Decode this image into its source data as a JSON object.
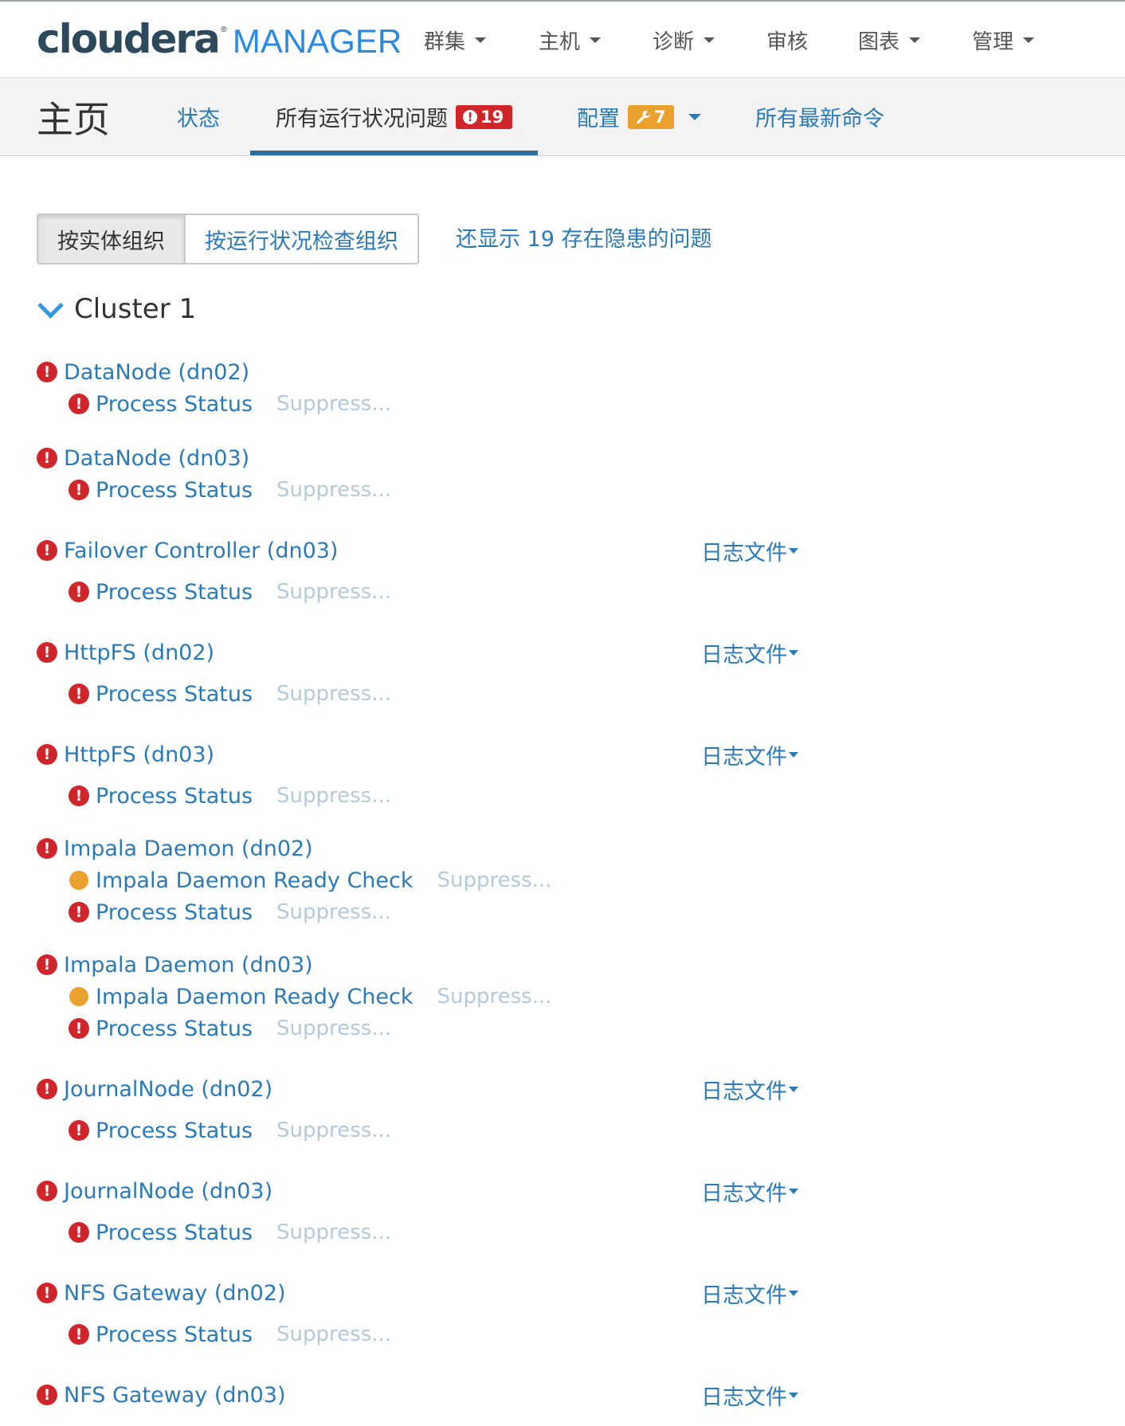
{
  "header": {
    "logo_main": "cloudera",
    "logo_reg": "®",
    "logo_product": "MANAGER",
    "nav": [
      {
        "label": "群集",
        "dropdown": true
      },
      {
        "label": "主机",
        "dropdown": true
      },
      {
        "label": "诊断",
        "dropdown": true
      },
      {
        "label": "审核",
        "dropdown": false
      },
      {
        "label": "图表",
        "dropdown": true
      },
      {
        "label": "管理",
        "dropdown": true
      }
    ]
  },
  "subheader": {
    "title": "主页",
    "tabs": [
      {
        "label": "状态"
      },
      {
        "label": "所有运行状况问题",
        "badge": "19",
        "badge_icon": "!",
        "active": true
      },
      {
        "label": "配置",
        "badge": "7",
        "badge_icon": "wrench-icon",
        "dropdown": true
      },
      {
        "label": "所有最新命令"
      }
    ]
  },
  "controls": {
    "group_by_entity": "按实体组织",
    "group_by_check": "按运行状况检查组织",
    "show_concerning": "还显示 19 存在隐患的问题"
  },
  "cluster": {
    "name": "Cluster 1"
  },
  "colors": {
    "link": "#2a7ab8",
    "critical": "#d0262b",
    "warning": "#eba12e",
    "suppress": "#b4c9da",
    "tab_underline": "#2f6f9f"
  },
  "logs_label": "日志文件",
  "suppress_label": "Suppress...",
  "entities": [
    {
      "name": "DataNode (dn02)",
      "status": "critical",
      "logs": false,
      "checks": [
        {
          "name": "Process Status",
          "status": "critical"
        }
      ]
    },
    {
      "name": "DataNode (dn03)",
      "status": "critical",
      "logs": false,
      "checks": [
        {
          "name": "Process Status",
          "status": "critical"
        }
      ]
    },
    {
      "name": "Failover Controller (dn03)",
      "status": "critical",
      "logs": true,
      "checks": [
        {
          "name": "Process Status",
          "status": "critical"
        }
      ]
    },
    {
      "name": "HttpFS (dn02)",
      "status": "critical",
      "logs": true,
      "checks": [
        {
          "name": "Process Status",
          "status": "critical"
        }
      ]
    },
    {
      "name": "HttpFS (dn03)",
      "status": "critical",
      "logs": true,
      "checks": [
        {
          "name": "Process Status",
          "status": "critical"
        }
      ]
    },
    {
      "name": "Impala Daemon (dn02)",
      "status": "critical",
      "logs": false,
      "checks": [
        {
          "name": "Impala Daemon Ready Check",
          "status": "warning"
        },
        {
          "name": "Process Status",
          "status": "critical"
        }
      ]
    },
    {
      "name": "Impala Daemon (dn03)",
      "status": "critical",
      "logs": false,
      "checks": [
        {
          "name": "Impala Daemon Ready Check",
          "status": "warning"
        },
        {
          "name": "Process Status",
          "status": "critical"
        }
      ]
    },
    {
      "name": "JournalNode (dn02)",
      "status": "critical",
      "logs": true,
      "checks": [
        {
          "name": "Process Status",
          "status": "critical"
        }
      ]
    },
    {
      "name": "JournalNode (dn03)",
      "status": "critical",
      "logs": true,
      "checks": [
        {
          "name": "Process Status",
          "status": "critical"
        }
      ]
    },
    {
      "name": "NFS Gateway (dn02)",
      "status": "critical",
      "logs": true,
      "checks": [
        {
          "name": "Process Status",
          "status": "critical"
        }
      ]
    },
    {
      "name": "NFS Gateway (dn03)",
      "status": "critical",
      "logs": true,
      "checks": []
    }
  ]
}
